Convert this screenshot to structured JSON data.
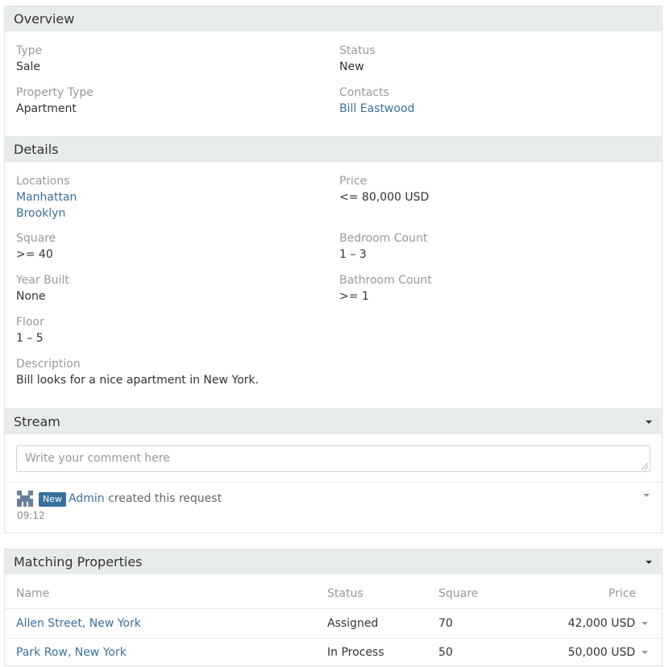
{
  "overview": {
    "title": "Overview",
    "type_label": "Type",
    "type_value": "Sale",
    "status_label": "Status",
    "status_value": "New",
    "property_type_label": "Property Type",
    "property_type_value": "Apartment",
    "contacts_label": "Contacts",
    "contacts_value": "Bill Eastwood"
  },
  "details": {
    "title": "Details",
    "locations_label": "Locations",
    "locations": [
      "Manhattan",
      "Brooklyn"
    ],
    "price_label": "Price",
    "price_value": "<= 80,000 USD",
    "square_label": "Square",
    "square_value": ">= 40",
    "bedroom_label": "Bedroom Count",
    "bedroom_value": "1 – 3",
    "year_built_label": "Year Built",
    "year_built_value": "None",
    "bathroom_label": "Bathroom Count",
    "bathroom_value": ">= 1",
    "floor_label": "Floor",
    "floor_value": "1 – 5",
    "description_label": "Description",
    "description_value": "Bill looks for a nice apartment in New York."
  },
  "stream": {
    "title": "Stream",
    "comment_placeholder": "Write your comment here",
    "note": {
      "badge": "New",
      "user": "Admin",
      "action": "created this request",
      "time": "09:12"
    }
  },
  "matching": {
    "title": "Matching Properties",
    "columns": {
      "name": "Name",
      "status": "Status",
      "square": "Square",
      "price": "Price"
    },
    "rows": [
      {
        "name": "Allen Street, New York",
        "status": "Assigned",
        "square": "70",
        "price": "42,000 USD"
      },
      {
        "name": "Park Row, New York",
        "status": "In Process",
        "square": "50",
        "price": "50,000 USD"
      }
    ]
  },
  "colors": {
    "link": "#3a6f9c",
    "panel_heading_bg": "#e8ebec",
    "label": "#999999",
    "badge_bg": "#3a6f9c"
  }
}
